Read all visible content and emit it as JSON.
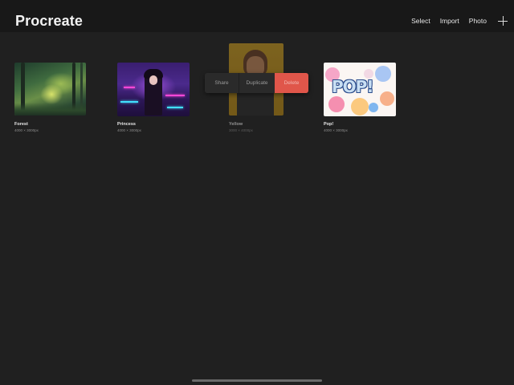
{
  "app": {
    "title": "Procreate"
  },
  "toolbar": {
    "select_label": "Select",
    "import_label": "Import",
    "photo_label": "Photo",
    "add_icon": "plus-icon"
  },
  "gallery": {
    "artworks": [
      {
        "name": "Forest",
        "size": "4000 × 3000px"
      },
      {
        "name": "Princess",
        "size": "4000 × 3000px"
      },
      {
        "name": "Yellow",
        "size": "3000 × 4000px"
      },
      {
        "name": "Pop!",
        "size": "4000 × 3000px"
      }
    ]
  },
  "context_menu": {
    "share_label": "Share",
    "duplicate_label": "Duplicate",
    "delete_label": "Delete",
    "delete_color": "#e0564a"
  },
  "colors": {
    "background": "#202020",
    "topbar": "#181818",
    "text": "#e6e6e6"
  }
}
